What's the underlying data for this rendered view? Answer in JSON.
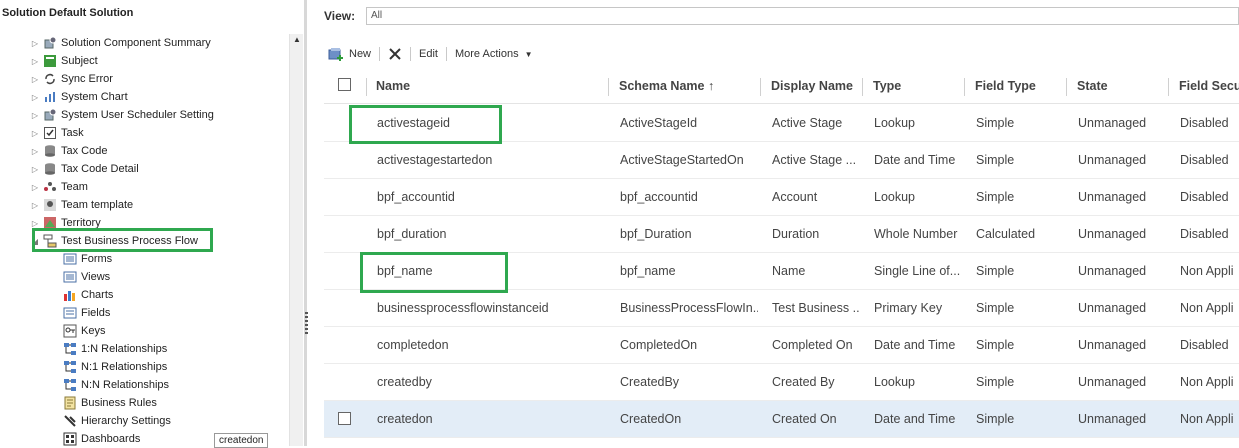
{
  "solution_title": "Solution Default Solution",
  "tree": [
    {
      "label": "Solution Component Summary",
      "icon": "solution-component-summary-icon"
    },
    {
      "label": "Subject",
      "icon": "subject-icon"
    },
    {
      "label": "Sync Error",
      "icon": "sync-error-icon"
    },
    {
      "label": "System Chart",
      "icon": "system-chart-icon"
    },
    {
      "label": "System User Scheduler Setting",
      "icon": "scheduler-setting-icon"
    },
    {
      "label": "Task",
      "icon": "task-icon"
    },
    {
      "label": "Tax Code",
      "icon": "tax-code-icon"
    },
    {
      "label": "Tax Code Detail",
      "icon": "tax-code-detail-icon"
    },
    {
      "label": "Team",
      "icon": "team-icon"
    },
    {
      "label": "Team template",
      "icon": "team-template-icon"
    },
    {
      "label": "Territory",
      "icon": "territory-icon"
    },
    {
      "label": "Test Business Process Flow",
      "icon": "business-process-flow-icon"
    }
  ],
  "subtree": [
    {
      "label": "Forms",
      "icon": "forms-icon"
    },
    {
      "label": "Views",
      "icon": "views-icon"
    },
    {
      "label": "Charts",
      "icon": "charts-icon"
    },
    {
      "label": "Fields",
      "icon": "fields-icon"
    },
    {
      "label": "Keys",
      "icon": "keys-icon"
    },
    {
      "label": "1:N Relationships",
      "icon": "one-to-many-icon"
    },
    {
      "label": "N:1 Relationships",
      "icon": "many-to-one-icon"
    },
    {
      "label": "N:N Relationships",
      "icon": "many-to-many-icon"
    },
    {
      "label": "Business Rules",
      "icon": "business-rules-icon"
    },
    {
      "label": "Hierarchy Settings",
      "icon": "hierarchy-settings-icon"
    },
    {
      "label": "Dashboards",
      "icon": "dashboards-icon"
    }
  ],
  "view": {
    "label": "View:",
    "value": "All"
  },
  "toolbar": {
    "new": "New",
    "edit": "Edit",
    "more_actions": "More Actions"
  },
  "columns": [
    "Name",
    "Schema Name",
    "Display Name",
    "Type",
    "Field Type",
    "State",
    "Field Secu"
  ],
  "sort_indicator": "↑",
  "rows": [
    [
      "activestageid",
      "ActiveStageId",
      "Active Stage",
      "Lookup",
      "Simple",
      "Unmanaged",
      "Disabled"
    ],
    [
      "activestagestartedon",
      "ActiveStageStartedOn",
      "Active Stage ...",
      "Date and Time",
      "Simple",
      "Unmanaged",
      "Disabled"
    ],
    [
      "bpf_accountid",
      "bpf_accountid",
      "Account",
      "Lookup",
      "Simple",
      "Unmanaged",
      "Disabled"
    ],
    [
      "bpf_duration",
      "bpf_Duration",
      "Duration",
      "Whole Number",
      "Calculated",
      "Unmanaged",
      "Disabled"
    ],
    [
      "bpf_name",
      "bpf_name",
      "Name",
      "Single Line of...",
      "Simple",
      "Unmanaged",
      "Non Appli"
    ],
    [
      "businessprocessflowinstanceid",
      "BusinessProcessFlowIn...",
      "Test Business ...",
      "Primary Key",
      "Simple",
      "Unmanaged",
      "Non Appli"
    ],
    [
      "completedon",
      "CompletedOn",
      "Completed On",
      "Date and Time",
      "Simple",
      "Unmanaged",
      "Disabled"
    ],
    [
      "createdby",
      "CreatedBy",
      "Created By",
      "Lookup",
      "Simple",
      "Unmanaged",
      "Non Appli"
    ],
    [
      "createdon",
      "CreatedOn",
      "Created On",
      "Date and Time",
      "Simple",
      "Unmanaged",
      "Non Appli"
    ]
  ],
  "tooltip": "createdon",
  "colors": {
    "highlight": "#2fa84f",
    "selected_row": "#e3edf7"
  }
}
